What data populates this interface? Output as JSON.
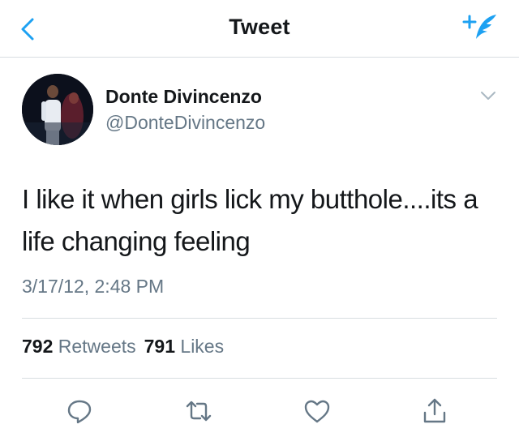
{
  "header": {
    "title": "Tweet",
    "back_icon": "chevron-left-icon",
    "compose_icon": "compose-tweet-icon"
  },
  "tweet": {
    "author_name": "Donte Divincenzo",
    "author_handle": "@DonteDivincenzo",
    "text": "I like it when girls lick my butthole....its a life changing feeling",
    "timestamp": "3/17/12, 2:48 PM",
    "retweets_count": "792",
    "retweets_label": "Retweets",
    "likes_count": "791",
    "likes_label": "Likes"
  },
  "actions": [
    "reply-icon",
    "retweet-icon",
    "like-icon",
    "share-icon"
  ],
  "colors": {
    "accent": "#1da1f2",
    "text": "#14171a",
    "muted": "#657786",
    "divider": "#d8dde1"
  }
}
